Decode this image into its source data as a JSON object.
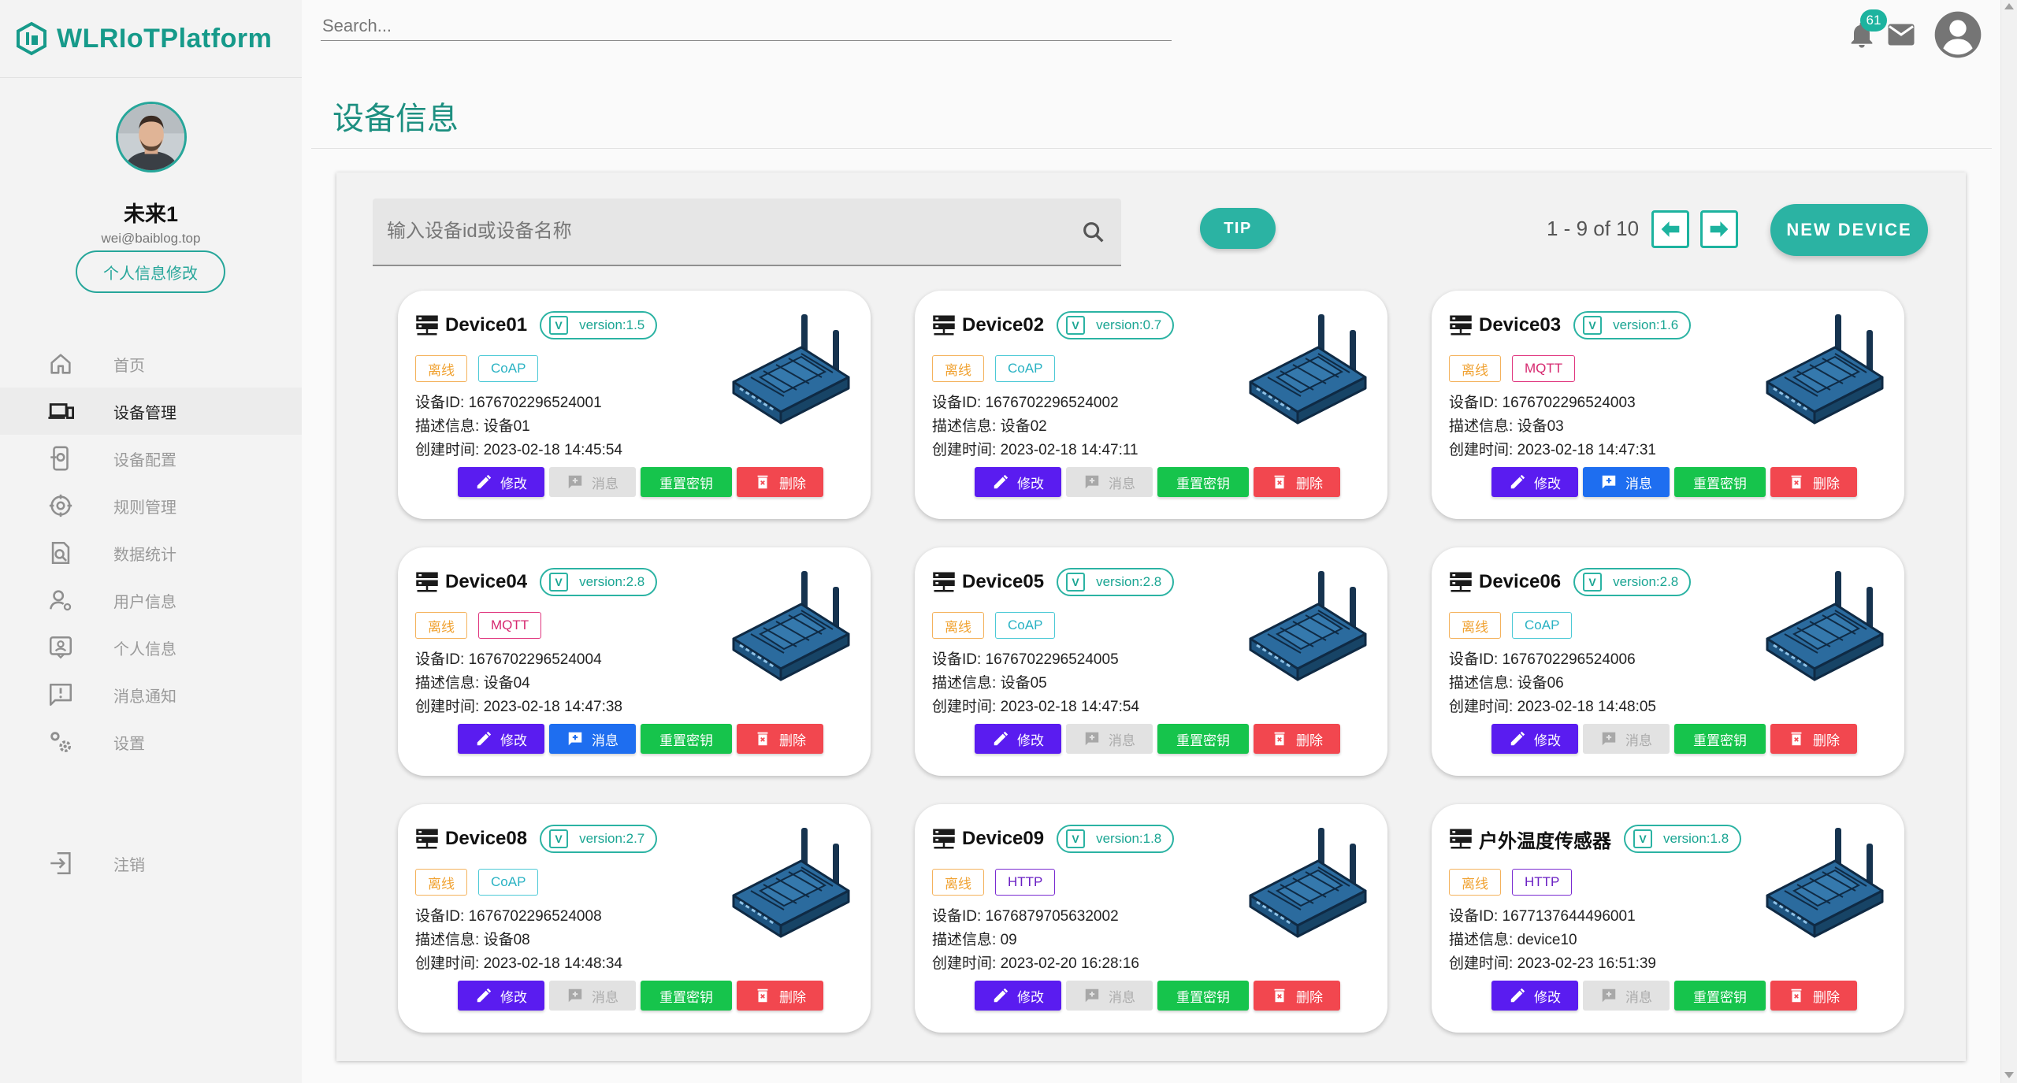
{
  "app": {
    "title": "WLRIoTPlatform"
  },
  "search": {
    "placeholder": "Search..."
  },
  "notifications": {
    "count": "61"
  },
  "profile": {
    "name": "未来1",
    "email": "wei@baiblog.top",
    "edit_label": "个人信息修改"
  },
  "menu": [
    {
      "label": "首页",
      "icon": "home-icon"
    },
    {
      "label": "设备管理",
      "icon": "devices-icon",
      "active": true
    },
    {
      "label": "设备配置",
      "icon": "device-config-icon"
    },
    {
      "label": "规则管理",
      "icon": "rules-icon"
    },
    {
      "label": "数据统计",
      "icon": "data-stats-icon"
    },
    {
      "label": "用户信息",
      "icon": "user-info-icon"
    },
    {
      "label": "个人信息",
      "icon": "personal-info-icon"
    },
    {
      "label": "消息通知",
      "icon": "notification-icon"
    },
    {
      "label": "设置",
      "icon": "settings-icon"
    }
  ],
  "logout": {
    "label": "注销"
  },
  "page": {
    "title": "设备信息"
  },
  "toolbar": {
    "search_placeholder": "输入设备id或设备名称",
    "tip_label": "TIP",
    "pager_text": "1 - 9 of 10",
    "new_device_label": "NEW DEVICE"
  },
  "labels": {
    "id_prefix": "设备ID: ",
    "desc_prefix": "描述信息: ",
    "created_prefix": "创建时间: ",
    "edit": "修改",
    "message": "消息",
    "reset_key": "重置密钥",
    "delete": "删除",
    "version_badge": "V"
  },
  "colors": {
    "accent": "#26a69a",
    "edit": "#5a1cf0",
    "message": "#1e6ef0",
    "reset_key": "#16c44c",
    "delete": "#f2474f"
  },
  "devices": [
    {
      "name": "Device01",
      "version": "version:1.5",
      "status": "离线",
      "protocol": "CoAP",
      "id": "1676702296524001",
      "desc": "设备01",
      "created": "2023-02-18 14:45:54",
      "message_enabled": false
    },
    {
      "name": "Device02",
      "version": "version:0.7",
      "status": "离线",
      "protocol": "CoAP",
      "id": "1676702296524002",
      "desc": "设备02",
      "created": "2023-02-18 14:47:11",
      "message_enabled": false
    },
    {
      "name": "Device03",
      "version": "version:1.6",
      "status": "离线",
      "protocol": "MQTT",
      "id": "1676702296524003",
      "desc": "设备03",
      "created": "2023-02-18 14:47:31",
      "message_enabled": true
    },
    {
      "name": "Device04",
      "version": "version:2.8",
      "status": "离线",
      "protocol": "MQTT",
      "id": "1676702296524004",
      "desc": "设备04",
      "created": "2023-02-18 14:47:38",
      "message_enabled": true
    },
    {
      "name": "Device05",
      "version": "version:2.8",
      "status": "离线",
      "protocol": "CoAP",
      "id": "1676702296524005",
      "desc": "设备05",
      "created": "2023-02-18 14:47:54",
      "message_enabled": false
    },
    {
      "name": "Device06",
      "version": "version:2.8",
      "status": "离线",
      "protocol": "CoAP",
      "id": "1676702296524006",
      "desc": "设备06",
      "created": "2023-02-18 14:48:05",
      "message_enabled": false
    },
    {
      "name": "Device08",
      "version": "version:2.7",
      "status": "离线",
      "protocol": "CoAP",
      "id": "1676702296524008",
      "desc": "设备08",
      "created": "2023-02-18 14:48:34",
      "message_enabled": false
    },
    {
      "name": "Device09",
      "version": "version:1.8",
      "status": "离线",
      "protocol": "HTTP",
      "id": "1676879705632002",
      "desc": "09",
      "created": "2023-02-20 16:28:16",
      "message_enabled": false
    },
    {
      "name": "户外温度传感器",
      "version": "version:1.8",
      "status": "离线",
      "protocol": "HTTP",
      "id": "1677137644496001",
      "desc": "device10",
      "created": "2023-02-23 16:51:39",
      "message_enabled": false
    }
  ]
}
